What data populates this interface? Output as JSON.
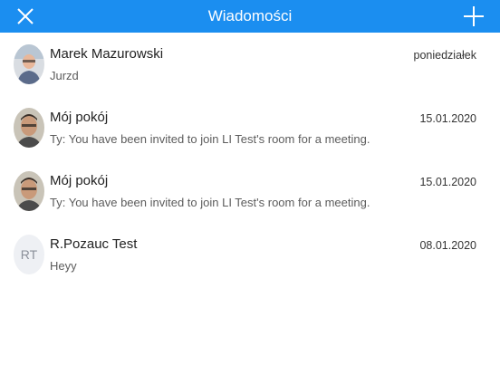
{
  "header": {
    "title": "Wiadomości",
    "background": "#1b8ef0"
  },
  "conversations": [
    {
      "name": "Marek Mazurowski",
      "preview": "Jurzd",
      "date": "poniedziałek",
      "avatar": "photo"
    },
    {
      "name": "Mój pokój",
      "preview": "Ty: You have been invited to join LI Test's room for a meeting.",
      "date": "15.01.2020",
      "avatar": "photo"
    },
    {
      "name": "Mój pokój",
      "preview": "Ty: You have been invited to join LI Test's room for a meeting.",
      "date": "15.01.2020",
      "avatar": "photo"
    },
    {
      "name": "R.Pozauc Test",
      "preview": "Heyy",
      "date": "08.01.2020",
      "avatar": "initials",
      "initials": "RT"
    }
  ]
}
